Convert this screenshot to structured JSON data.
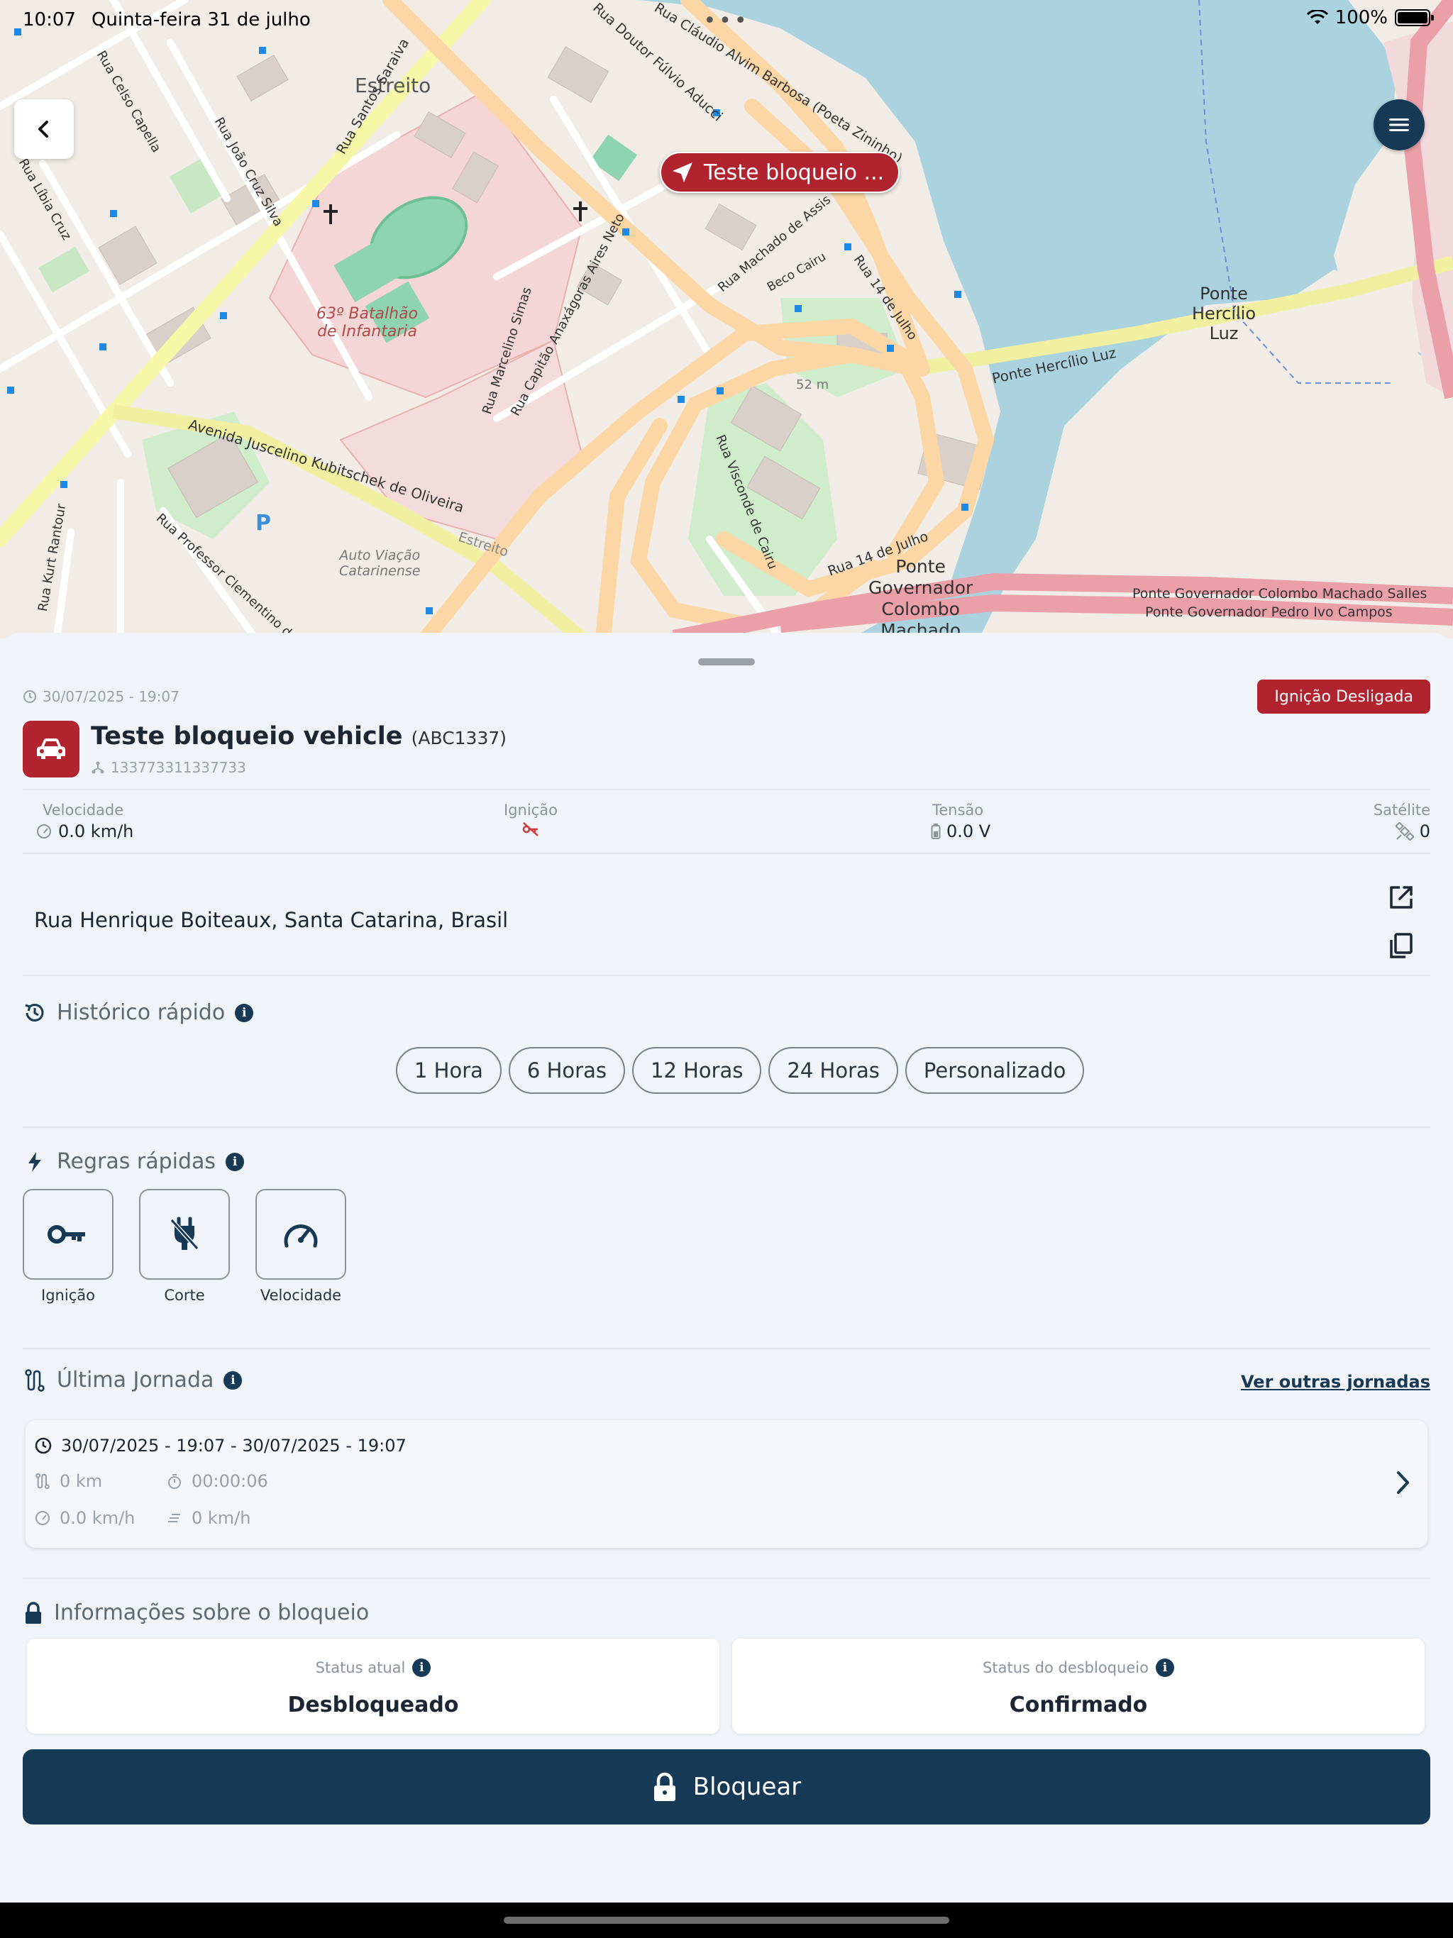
{
  "status_bar": {
    "time": "10:07",
    "date": "Quinta-feira 31 de julho",
    "battery": "100%"
  },
  "map": {
    "vehicle_label": "Teste bloqueio ...",
    "labels": {
      "estreito": "Estreito",
      "batalhao_1": "63º Batalhão",
      "batalhao_2": "de Infantaria",
      "auto_viacao_1": "Auto Viação",
      "auto_viacao_2": "Catarinense",
      "ponte_hl_1": "Ponte",
      "ponte_hl_2": "Hercílio",
      "ponte_hl_3": "Luz",
      "ponte_gcm_1": "Ponte",
      "ponte_gcm_2": "Governador",
      "ponte_gcm_3": "Colombo",
      "ponte_gcm_4": "Machado",
      "rua_santos_saraiva": "Rua Santos Saraiva",
      "rua_joao_cruz_silva": "Rua João Cruz Silva",
      "rua_celso_capella": "Rua Celso Capella",
      "rua_libia_cruz": "Rua Líbia Cruz",
      "rua_fulvio_aducci": "Rua Doutor Fúlvio Aducci",
      "rua_claudio_barbosa": "Rua Cláudio Alvim Barbosa (Poeta Zininho)",
      "av_jk": "Avenida Juscelino Kubitschek de Oliveira",
      "rua_marcelino": "Rua Marcelino Simas",
      "rua_capitao": "Rua Capitão Anaxágoras Aires Neto",
      "rua_machado_assis": "Rua Machado de Assis",
      "beco_cairu": "Beco Cairu",
      "rua_14_julho": "Rua 14 de Julho",
      "rua_visconde": "Rua Visconde de Cairu",
      "ponte_hl_road": "Ponte Hercílio Luz",
      "ponte_gcm_road": "Ponte Governador Colombo Machado Salles",
      "ponte_gpic_road": "Ponte Governador Pedro Ivo Campos",
      "estreito_road": "Estreito",
      "rua_professor": "Rua Professor Clementino de Brito",
      "rua_kurt": "Rua Kurt Rantour",
      "scale": "52 m"
    }
  },
  "vehicle": {
    "timestamp": "30/07/2025 - 19:07",
    "ignition_badge": "Ignição Desligada",
    "name": "Teste bloqueio vehicle",
    "plate": "(ABC1337)",
    "imei": "133773311337733"
  },
  "stats": {
    "speed_label": "Velocidade",
    "speed_value": "0.0 km/h",
    "ignition_label": "Ignição",
    "voltage_label": "Tensão",
    "voltage_value": "0.0 V",
    "satellite_label": "Satélite",
    "satellite_value": "0"
  },
  "address": "Rua Henrique Boiteaux, Santa Catarina, Brasil",
  "quick_history": {
    "title": "Histórico rápido",
    "chips": [
      "1 Hora",
      "6 Horas",
      "12 Horas",
      "24 Horas",
      "Personalizado"
    ]
  },
  "quick_rules": {
    "title": "Regras rápidas",
    "items": [
      {
        "label": "Ignição",
        "icon": "key-icon"
      },
      {
        "label": "Corte",
        "icon": "plug-off-icon"
      },
      {
        "label": "Velocidade",
        "icon": "speedometer-icon"
      }
    ]
  },
  "last_journey": {
    "title": "Última Jornada",
    "link": "Ver outras jornadas",
    "period": "30/07/2025 - 19:07 - 30/07/2025 - 19:07",
    "distance": "0 km",
    "duration": "00:00:06",
    "avg_speed": "0.0 km/h",
    "max_speed": "0 km/h"
  },
  "lock_info": {
    "title": "Informações sobre o bloqueio",
    "current_label": "Status atual",
    "current_value": "Desbloqueado",
    "unlock_label": "Status do desbloqueio",
    "unlock_value": "Confirmado",
    "button": "Bloquear"
  },
  "colors": {
    "primary": "#163a55",
    "danger": "#b1232f",
    "background": "#f0f3f7"
  }
}
